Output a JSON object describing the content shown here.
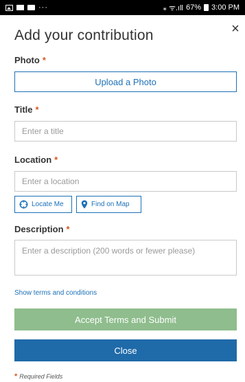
{
  "status_bar": {
    "overflow": "···",
    "signal_text": "⁎ ᯤ.ıll",
    "battery_percent": "67%",
    "time": "3:00 PM"
  },
  "dialog": {
    "title": "Add your contribution",
    "close_glyph": "×"
  },
  "required_marker": "*",
  "photo": {
    "label": "Photo",
    "upload_label": "Upload a Photo"
  },
  "title_field": {
    "label": "Title",
    "placeholder": "Enter a title"
  },
  "location": {
    "label": "Location",
    "placeholder": "Enter a location",
    "locate_me_label": "Locate Me",
    "find_on_map_label": "Find on Map"
  },
  "description": {
    "label": "Description",
    "placeholder": "Enter a description (200 words or fewer please)"
  },
  "terms_link": "Show terms and conditions",
  "submit_label": "Accept Terms and Submit",
  "close_label": "Close",
  "footnote": "Required Fields",
  "colors": {
    "accent": "#1d70b7",
    "required": "#d35a27",
    "submit_disabled": "#8fbd8d",
    "close_button": "#1f6aa9"
  }
}
